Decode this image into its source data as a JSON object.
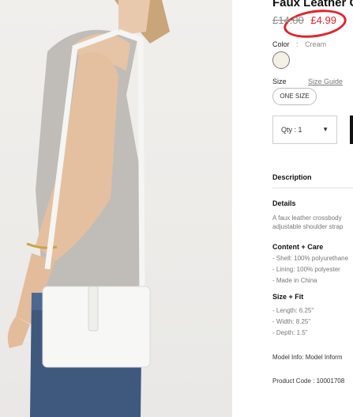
{
  "product": {
    "title": "Faux Leather C",
    "price_old": "£14.00",
    "price_new": "£4.99"
  },
  "color": {
    "label": "Color",
    "sep": ":",
    "value": "Cream"
  },
  "size": {
    "label": "Size",
    "guide": "Size Guide",
    "option": "ONE SIZE"
  },
  "quantity": {
    "label": "Qty : 1",
    "caret": "▼"
  },
  "description": {
    "heading": "Description",
    "details_heading": "Details",
    "details_text": [
      "A faux leather crossbody",
      "adjustable shoulder strap"
    ]
  },
  "content_care": {
    "heading": "Content + Care",
    "items": [
      "- Shell: 100% polyurethane",
      "- Lining: 100% polyester",
      "- Made in China"
    ]
  },
  "size_fit": {
    "heading": "Size + Fit",
    "items": [
      "- Length: 6.25\"",
      "- Width: 8.25\"",
      "- Depth: 1.5\""
    ]
  },
  "model_info": "Model Info: Model Inform",
  "product_code": "Product Code : 10001708"
}
